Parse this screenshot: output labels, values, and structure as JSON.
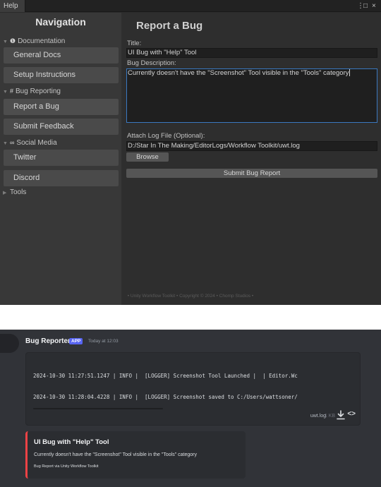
{
  "editor": {
    "tab_label": "Help",
    "controls": {
      "menu": "⋮",
      "maximize": "□",
      "close": "×"
    },
    "nav": {
      "title": "Navigation",
      "categories": [
        {
          "label": "Documentation",
          "icon": "book-icon",
          "buttons": [
            "General Docs",
            "Setup Instructions"
          ]
        },
        {
          "label": "Bug Reporting",
          "icon": "bug-icon",
          "buttons": [
            "Report a Bug",
            "Submit Feedback"
          ]
        },
        {
          "label": "Social Media",
          "icon": "social-icon",
          "buttons": [
            "Twitter",
            "Discord"
          ]
        },
        {
          "label": "Tools",
          "icon": "",
          "buttons": []
        }
      ]
    },
    "form": {
      "title": "Report a Bug",
      "title_label": "Title:",
      "title_value": "UI Bug with \"Help\" Tool",
      "description_label": "Bug Description:",
      "description_value": "Currently doesn't have the \"Screenshot\" Tool visible in the \"Tools\" category",
      "log_label": "Attach Log File (Optional):",
      "log_path": "D:/Star In The Making/EditorLogs/Workflow Toolkit/uwt.log",
      "browse_label": "Browse",
      "submit_label": "Submit Bug Report"
    },
    "footer": "• Unity Workflow Toolkit • Copyright © 2024 • Chomp Studios •"
  },
  "discord": {
    "author": "Bug Reporter",
    "badge": "APP",
    "timestamp": "Today at 12:03",
    "log_lines": [
      "2024-10-30 11:27:51.1247 | INFO |  [LOGGER] Screenshot Tool Launched |  | Editor.Wc",
      "2024-10-30 11:28:04.4228 | INFO |  [LOGGER] Screenshot saved to C:/Users/wattsoner/"
    ],
    "file_name": "uwt.log",
    "file_size": "1 KB",
    "embed": {
      "title": "UI Bug with \"Help\" Tool",
      "description": "Currently doesn't have the \"Screenshot\" Tool visible in the \"Tools\" category",
      "footer": "Bug Report via Unity Workflow Toolkit",
      "accent_color": "#ed4245"
    }
  }
}
